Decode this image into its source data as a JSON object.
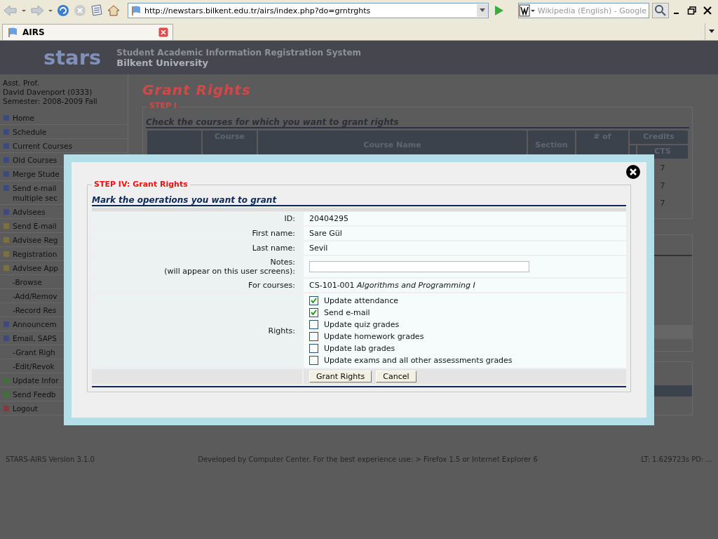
{
  "browser": {
    "url": "http://newstars.bilkent.edu.tr/airs/index.php?do=grntrghts",
    "search_placeholder": "Wikipedia (English) - Google",
    "tab_title": "AIRS"
  },
  "header": {
    "logo": "stars",
    "system_name": "Student Academic Information Registration System",
    "university": "Bilkent University"
  },
  "user": [
    "Asst. Prof.",
    "David Davenport (0333)",
    "Semester: 2008-2009 Fall"
  ],
  "sidebar": [
    {
      "label": "Home",
      "kind": "item",
      "color": "#3b4b80"
    },
    {
      "label": "Schedule",
      "kind": "item",
      "color": "#3b4b80"
    },
    {
      "label": "Current Courses",
      "kind": "item",
      "color": "#3b4b80"
    },
    {
      "label": "Old Courses",
      "kind": "item",
      "color": "#3b4b80"
    },
    {
      "label": "Merge Stude",
      "kind": "item",
      "color": "#3b4b80"
    },
    {
      "label": "Send e-mail\nmultiple sec",
      "kind": "item",
      "color": "#3b4b80"
    },
    {
      "label": "Advisees",
      "kind": "item",
      "color": "#3b4b80"
    },
    {
      "label": "Send E-mail",
      "kind": "item",
      "color": "#7d703c"
    },
    {
      "label": "Advisee Reg",
      "kind": "item",
      "color": "#7d703c"
    },
    {
      "label": "Registration",
      "kind": "item",
      "color": "#7d703c"
    },
    {
      "label": "Advisee App",
      "kind": "item",
      "color": "#7d703c"
    },
    {
      "label": "-Browse",
      "kind": "sub"
    },
    {
      "label": "-Add/Remov",
      "kind": "sub"
    },
    {
      "label": "-Record Res",
      "kind": "sub"
    },
    {
      "label": "Announcem",
      "kind": "item",
      "color": "#3b4b80"
    },
    {
      "label": "Email, SAPS",
      "kind": "item",
      "color": "#3b4b80"
    },
    {
      "label": "-Grant Righ",
      "kind": "sub"
    },
    {
      "label": "-Edit/Revok",
      "kind": "sub"
    },
    {
      "label": "Update Infor",
      "kind": "item",
      "color": "#3f7236"
    },
    {
      "label": "Send Feedb",
      "kind": "item",
      "color": "#3f7236"
    },
    {
      "label": "Logout",
      "kind": "item",
      "color": "#833a3a"
    }
  ],
  "page": {
    "title": "Grant Rights",
    "step": "STEP I",
    "instruction": "Check the courses for which you want to grant rights",
    "columns": [
      "",
      "Course",
      "Course Name",
      "Section",
      "# of"
    ],
    "credits": "Credits",
    "credit_columns": [
      "",
      "CTS"
    ],
    "rows": [
      [
        "7"
      ],
      [
        "7"
      ],
      [
        "7"
      ]
    ]
  },
  "modal": {
    "step": "STEP IV: Grant Rights",
    "instruction": "Mark the operations you want to grant",
    "fields": [
      {
        "label": [
          "ID:"
        ],
        "kind": "text",
        "value": "20404295"
      },
      {
        "label": [
          "First name:"
        ],
        "kind": "text",
        "value": "Sare Gül"
      },
      {
        "label": [
          "Last name:"
        ],
        "kind": "text",
        "value": "Sevil"
      },
      {
        "label": [
          "Notes:",
          "(will appear on this user screens):"
        ],
        "kind": "input"
      },
      {
        "label": [
          "For courses:"
        ],
        "kind": "text",
        "value": "CS-101-001 *Algorithms and Programming I*"
      }
    ],
    "rights_label": "Rights:",
    "rights": [
      {
        "label": "Update attendance",
        "checked": true
      },
      {
        "label": "Send e-mail",
        "checked": true
      },
      {
        "label": "Update quiz grades",
        "checked": false
      },
      {
        "label": "Update homework grades",
        "checked": false
      },
      {
        "label": "Update lab grades",
        "checked": false
      },
      {
        "label": "Update exams and all other assessments grades",
        "checked": false
      }
    ],
    "buttons": [
      "Grant Rights",
      "Cancel"
    ]
  },
  "footer": {
    "version": "STARS-AIRS Version 3.1.0",
    "developed": "Developed by Computer Center. For the best experience use: > Firefox 1.5 or Internet Explorer 6",
    "timing": "LT: 1.629723s PD: ..."
  }
}
